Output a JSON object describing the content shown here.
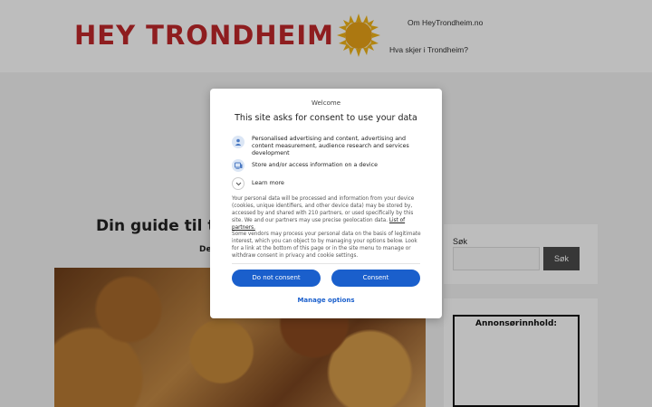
{
  "header": {
    "logo_text": "HEY TRONDHEIM",
    "nav": [
      {
        "label": "Om HeyTrondheim.no"
      },
      {
        "label": "Hva skjer i Trondheim?"
      }
    ]
  },
  "article": {
    "headline": "Din guide til t",
    "byline": "De"
  },
  "sidebar": {
    "search_label": "Søk",
    "search_button": "Søk",
    "ad_label": "Annonsørinnhold:"
  },
  "consent": {
    "welcome": "Welcome",
    "title": "This site asks for consent to use your data",
    "purposes": [
      {
        "icon": "person-icon",
        "text": "Personalised advertising and content, advertising and content measurement, audience research and services development"
      },
      {
        "icon": "device-icon",
        "text": "Store and/or access information on a device"
      },
      {
        "icon": "chevron-down-icon",
        "text": "Learn more"
      }
    ],
    "body1": "Your personal data will be processed and information from your device (cookies, unique identifiers, and other device data) may be stored by, accessed by and shared with 210 partners, or used specifically by this site. We and our partners may use precise geolocation data.",
    "partners_link": "List of partners.",
    "body2": "Some vendors may process your personal data on the basis of legitimate interest, which you can object to by managing your options below. Look for a link at the bottom of this page or in the site menu to manage or withdraw consent in privacy and cookie settings.",
    "do_not_consent": "Do not consent",
    "consent_button": "Consent",
    "manage_options": "Manage options"
  },
  "colors": {
    "brand_red": "#c0282b",
    "consent_blue": "#1a5fcc",
    "sun_yellow": "#f0b418"
  }
}
